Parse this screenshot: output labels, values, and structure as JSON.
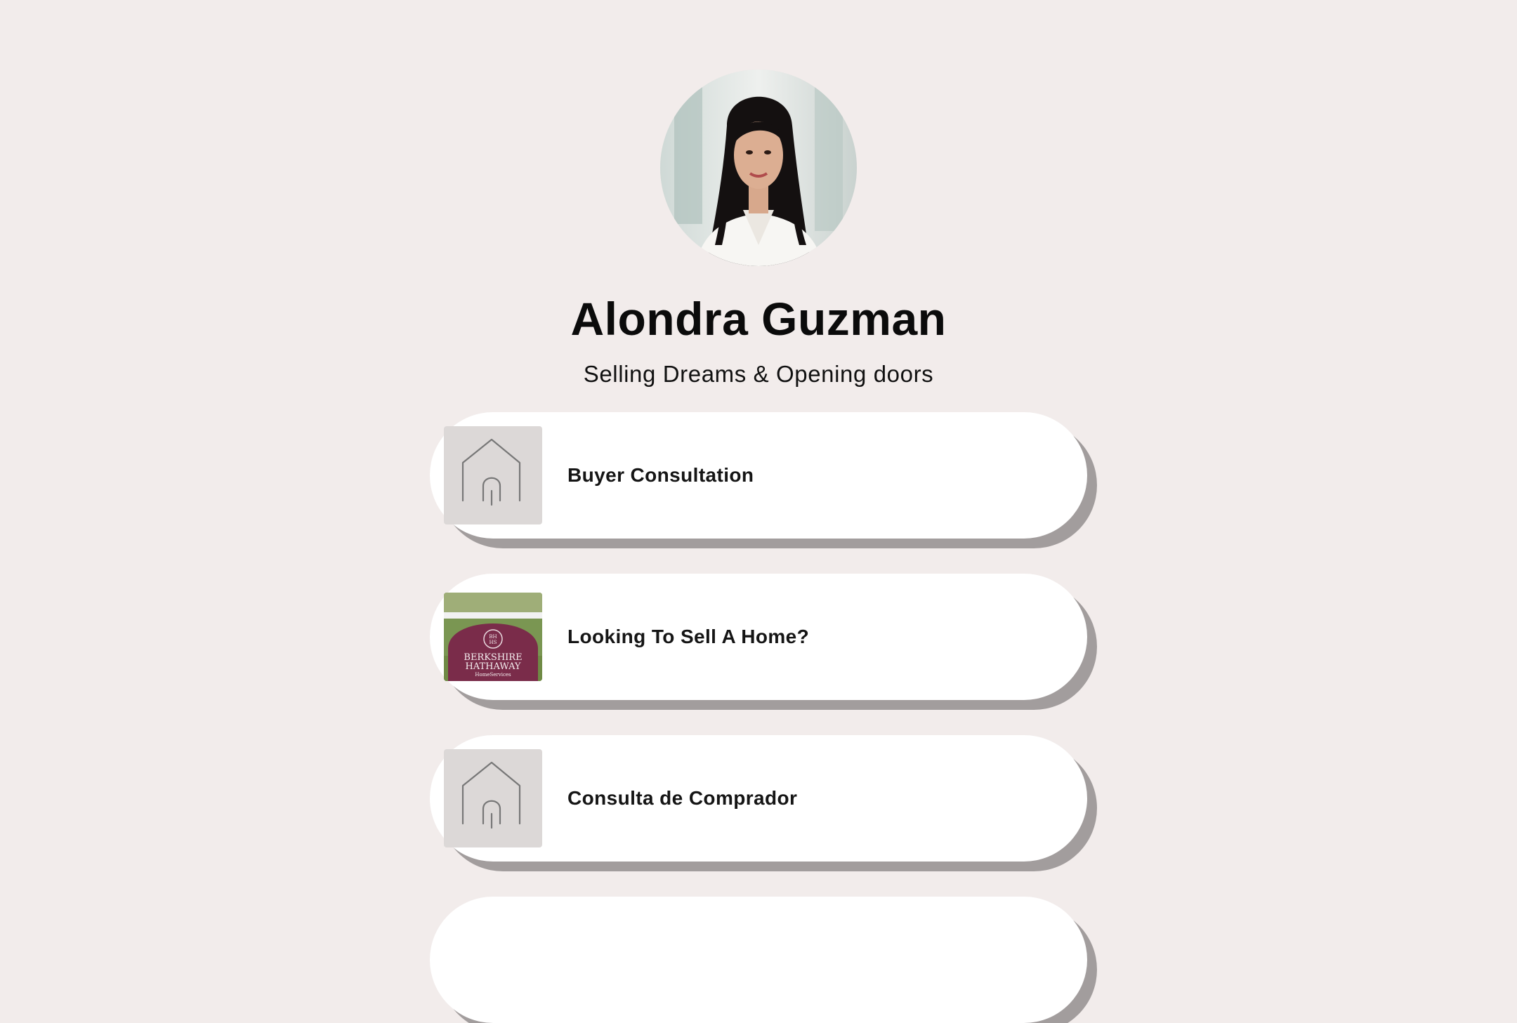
{
  "profile": {
    "name": "Alondra Guzman",
    "tagline": "Selling Dreams & Opening doors",
    "avatar_icon": "profile-photo"
  },
  "links": [
    {
      "label": "Buyer Consultation",
      "thumb_icon": "house-outline-icon"
    },
    {
      "label": "Looking To Sell A Home?",
      "thumb_icon": "berkshire-hathaway-sign-image",
      "thumb_text": [
        "BERKSHIRE",
        "HATHAWAY",
        "HomeServices",
        "BH",
        "HS"
      ]
    },
    {
      "label": "Consulta de Comprador",
      "thumb_icon": "house-outline-icon"
    },
    {
      "label": ""
    }
  ],
  "colors": {
    "background": "#f2eceb",
    "card": "#ffffff",
    "card_shadow": "#a29d9d",
    "thumb_bg": "#dcd8d7",
    "sign": "#7a2c4a"
  }
}
